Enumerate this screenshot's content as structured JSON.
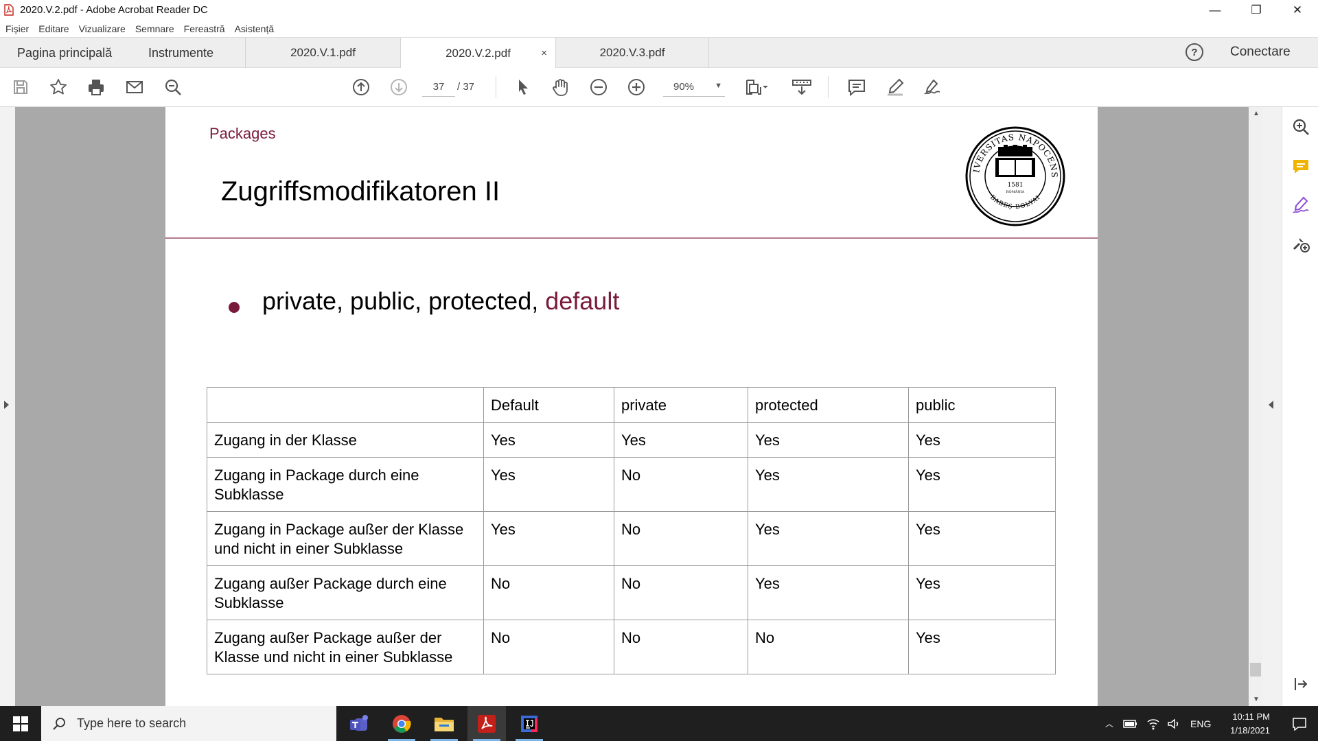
{
  "window": {
    "title": "2020.V.2.pdf - Adobe Acrobat Reader DC",
    "minimize": "—",
    "restore": "❐",
    "close": "✕"
  },
  "menu": [
    "Fișier",
    "Editare",
    "Vizualizare",
    "Semnare",
    "Fereastră",
    "Asistență"
  ],
  "tabs": {
    "home": "Pagina principală",
    "tools": "Instrumente",
    "docs": [
      "2020.V.1.pdf",
      "2020.V.2.pdf",
      "2020.V.3.pdf"
    ],
    "active_index": 1,
    "close_glyph": "×",
    "help": "?",
    "connect": "Conectare"
  },
  "toolbar": {
    "current_page": "37",
    "total_pages": "/ 37",
    "zoom": "90%",
    "zoom_caret": "▼",
    "icons": [
      "save-icon",
      "bookmark-star-icon",
      "print-icon",
      "email-icon",
      "find-icon",
      "prev-page-icon",
      "next-page-icon",
      "select-cursor-icon",
      "hand-icon",
      "zoom-out-icon",
      "zoom-in-icon",
      "fit-page-icon",
      "scroll-mode-icon",
      "comment-icon",
      "highlight-icon",
      "sign-icon"
    ]
  },
  "slide": {
    "section": "Packages",
    "heading": "Zugriffsmodifikatoren II",
    "bullet_prefix": "private, public, protected, ",
    "bullet_highlight": "default",
    "accent_color": "#7a1a3a",
    "seal_text_top": "UNIVERSITAS NAPOCENSIS",
    "seal_text_bottom": "BABEȘ-BOLYAI",
    "seal_year": "1581",
    "seal_country": "ROMÂNIA",
    "seal_book_lines": [
      "TRADITIO NOSTRA",
      "UNACUM EUROPAE",
      "VIRTUTIBUS SPLENDET"
    ]
  },
  "table": {
    "headers": [
      "",
      "Default",
      "private",
      "protected",
      "public"
    ],
    "rows": [
      {
        "label": "Zugang in der Klasse",
        "values": [
          "Yes",
          "Yes",
          "Yes",
          "Yes"
        ]
      },
      {
        "label": "Zugang in Package durch eine Subklasse",
        "values": [
          "Yes",
          "No",
          "Yes",
          "Yes"
        ]
      },
      {
        "label": "Zugang in Package außer der Klasse und nicht in einer Subklasse",
        "values": [
          "Yes",
          "No",
          "Yes",
          "Yes"
        ]
      },
      {
        "label": "Zugang außer Package durch eine Subklasse",
        "values": [
          "No",
          "No",
          "Yes",
          "Yes"
        ]
      },
      {
        "label": "Zugang außer Package außer der Klasse und nicht in einer Subklasse",
        "values": [
          "No",
          "No",
          "No",
          "Yes"
        ]
      }
    ]
  },
  "right_panel": {
    "icons": [
      "zoom-search-icon",
      "comment-icon",
      "fill-sign-icon",
      "more-tools-icon",
      "collapse-panel-icon"
    ],
    "comment_color": "#f0b400",
    "sign_color": "#8b4bd6"
  },
  "taskbar": {
    "search_placeholder": "Type here to search",
    "apps": [
      "teams-icon",
      "chrome-icon",
      "file-explorer-icon",
      "acrobat-icon",
      "intellij-icon"
    ],
    "language": "ENG",
    "time": "10:11 PM",
    "date": "1/18/2021"
  }
}
